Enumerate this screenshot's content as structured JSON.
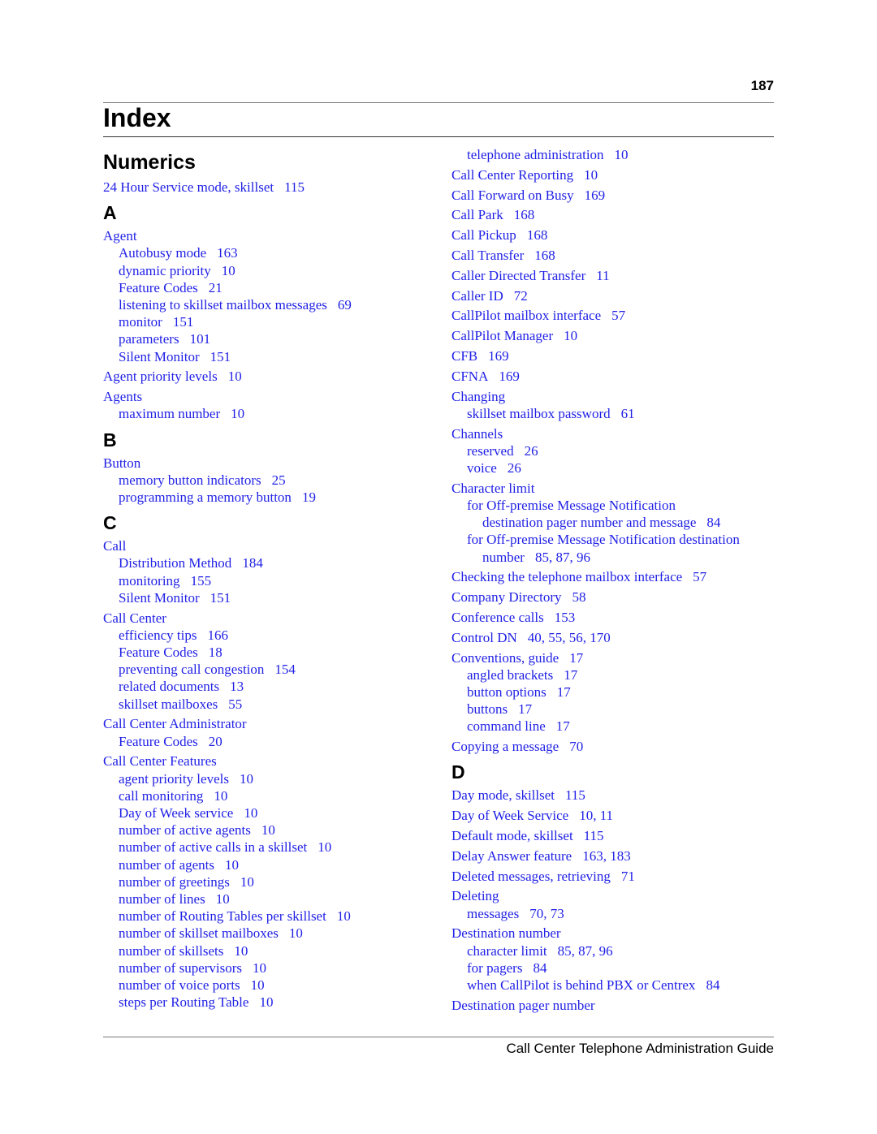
{
  "page": {
    "number": "187",
    "title": "Index",
    "footer": "Call Center Telephone Administration Guide"
  },
  "colors": {
    "link": "#1f1fe6",
    "heading": "#000000"
  },
  "columns": [
    [
      {
        "type": "head",
        "style": "big",
        "text": "Numerics"
      },
      {
        "level": 0,
        "text": "24 Hour Service mode, skillset",
        "pages": "115"
      },
      {
        "type": "head",
        "style": "letter",
        "text": "A"
      },
      {
        "level": 0,
        "text": "Agent",
        "pages": ""
      },
      {
        "level": 1,
        "text": "Autobusy mode",
        "pages": "163"
      },
      {
        "level": 1,
        "text": "dynamic priority",
        "pages": "10"
      },
      {
        "level": 1,
        "text": "Feature Codes",
        "pages": "21"
      },
      {
        "level": 1,
        "text": "listening to skillset mailbox messages",
        "pages": "69"
      },
      {
        "level": 1,
        "text": "monitor",
        "pages": "151"
      },
      {
        "level": 1,
        "text": "parameters",
        "pages": "101"
      },
      {
        "level": 1,
        "text": "Silent Monitor",
        "pages": "151"
      },
      {
        "level": 0,
        "text": "Agent priority levels",
        "pages": "10"
      },
      {
        "level": 0,
        "text": "Agents",
        "pages": ""
      },
      {
        "level": 1,
        "text": "maximum number",
        "pages": "10"
      },
      {
        "type": "head",
        "style": "letter",
        "text": "B"
      },
      {
        "level": 0,
        "text": "Button",
        "pages": ""
      },
      {
        "level": 1,
        "text": "memory button indicators",
        "pages": "25"
      },
      {
        "level": 1,
        "text": "programming a memory button",
        "pages": "19"
      },
      {
        "type": "head",
        "style": "letter",
        "text": "C"
      },
      {
        "level": 0,
        "text": "Call",
        "pages": ""
      },
      {
        "level": 1,
        "text": "Distribution Method",
        "pages": "184"
      },
      {
        "level": 1,
        "text": "monitoring",
        "pages": "155"
      },
      {
        "level": 1,
        "text": "Silent Monitor",
        "pages": "151"
      },
      {
        "level": 0,
        "text": "Call Center",
        "pages": ""
      },
      {
        "level": 1,
        "text": "efficiency tips",
        "pages": "166"
      },
      {
        "level": 1,
        "text": "Feature Codes",
        "pages": "18"
      },
      {
        "level": 1,
        "text": "preventing call congestion",
        "pages": "154"
      },
      {
        "level": 1,
        "text": "related documents",
        "pages": "13"
      },
      {
        "level": 1,
        "text": "skillset mailboxes",
        "pages": "55"
      },
      {
        "level": 0,
        "text": "Call Center Administrator",
        "pages": ""
      },
      {
        "level": 1,
        "text": "Feature Codes",
        "pages": "20"
      },
      {
        "level": 0,
        "text": "Call Center Features",
        "pages": ""
      },
      {
        "level": 1,
        "text": "agent priority levels",
        "pages": "10"
      },
      {
        "level": 1,
        "text": "call monitoring",
        "pages": "10"
      },
      {
        "level": 1,
        "text": "Day of Week service",
        "pages": "10"
      },
      {
        "level": 1,
        "text": "number of active agents",
        "pages": "10"
      },
      {
        "level": 1,
        "text": "number of active calls in a skillset",
        "pages": "10"
      },
      {
        "level": 1,
        "text": "number of agents",
        "pages": "10"
      },
      {
        "level": 1,
        "text": "number of greetings",
        "pages": "10"
      },
      {
        "level": 1,
        "text": "number of lines",
        "pages": "10"
      },
      {
        "level": 1,
        "text": "number of Routing Tables per skillset",
        "pages": "10"
      },
      {
        "level": 1,
        "text": "number of skillset mailboxes",
        "pages": "10"
      },
      {
        "level": 1,
        "text": "number of skillsets",
        "pages": "10"
      },
      {
        "level": 1,
        "text": "number of supervisors",
        "pages": "10"
      },
      {
        "level": 1,
        "text": "number of voice ports",
        "pages": "10"
      },
      {
        "level": 1,
        "text": "steps per Routing Table",
        "pages": "10"
      }
    ],
    [
      {
        "level": 1,
        "text": "telephone administration",
        "pages": "10"
      },
      {
        "level": 0,
        "text": "Call Center Reporting",
        "pages": "10"
      },
      {
        "level": 0,
        "text": "Call Forward on Busy",
        "pages": "169"
      },
      {
        "level": 0,
        "text": "Call Park",
        "pages": "168"
      },
      {
        "level": 0,
        "text": "Call Pickup",
        "pages": "168"
      },
      {
        "level": 0,
        "text": "Call Transfer",
        "pages": "168"
      },
      {
        "level": 0,
        "text": "Caller Directed Transfer",
        "pages": "11"
      },
      {
        "level": 0,
        "text": "Caller ID",
        "pages": "72"
      },
      {
        "level": 0,
        "text": "CallPilot mailbox interface",
        "pages": "57"
      },
      {
        "level": 0,
        "text": "CallPilot Manager",
        "pages": "10"
      },
      {
        "level": 0,
        "text": "CFB",
        "pages": "169"
      },
      {
        "level": 0,
        "text": "CFNA",
        "pages": "169"
      },
      {
        "level": 0,
        "text": "Changing",
        "pages": ""
      },
      {
        "level": 1,
        "text": "skillset mailbox password",
        "pages": "61"
      },
      {
        "level": 0,
        "text": "Channels",
        "pages": ""
      },
      {
        "level": 1,
        "text": "reserved",
        "pages": "26"
      },
      {
        "level": 1,
        "text": "voice",
        "pages": "26"
      },
      {
        "level": 0,
        "text": "Character limit",
        "pages": ""
      },
      {
        "level": 1,
        "text": "for Off-premise Message Notification",
        "pages": ""
      },
      {
        "level": 2,
        "text": "destination pager number and message",
        "pages": "84"
      },
      {
        "level": 1,
        "text": "for Off-premise Message Notification destination",
        "pages": ""
      },
      {
        "level": 2,
        "text": "number",
        "pages": "85, 87, 96"
      },
      {
        "level": 0,
        "text": "Checking the telephone mailbox interface",
        "pages": "57"
      },
      {
        "level": 0,
        "text": "Company Directory",
        "pages": "58"
      },
      {
        "level": 0,
        "text": "Conference calls",
        "pages": "153"
      },
      {
        "level": 0,
        "text": "Control DN",
        "pages": "40, 55, 56, 170"
      },
      {
        "level": 0,
        "text": "Conventions, guide",
        "pages": "17"
      },
      {
        "level": 1,
        "text": "angled brackets",
        "pages": "17"
      },
      {
        "level": 1,
        "text": "button options",
        "pages": "17"
      },
      {
        "level": 1,
        "text": "buttons",
        "pages": "17"
      },
      {
        "level": 1,
        "text": "command line",
        "pages": "17"
      },
      {
        "level": 0,
        "text": "Copying a message",
        "pages": "70"
      },
      {
        "type": "head",
        "style": "letter",
        "text": "D"
      },
      {
        "level": 0,
        "text": "Day mode, skillset",
        "pages": "115"
      },
      {
        "level": 0,
        "text": "Day of Week Service",
        "pages": "10, 11"
      },
      {
        "level": 0,
        "text": "Default mode, skillset",
        "pages": "115"
      },
      {
        "level": 0,
        "text": "Delay Answer feature",
        "pages": "163, 183"
      },
      {
        "level": 0,
        "text": "Deleted messages, retrieving",
        "pages": "71"
      },
      {
        "level": 0,
        "text": "Deleting",
        "pages": ""
      },
      {
        "level": 1,
        "text": "messages",
        "pages": "70, 73"
      },
      {
        "level": 0,
        "text": "Destination number",
        "pages": ""
      },
      {
        "level": 1,
        "text": "character limit",
        "pages": "85, 87, 96"
      },
      {
        "level": 1,
        "text": "for pagers",
        "pages": "84"
      },
      {
        "level": 1,
        "text": "when CallPilot is behind PBX or Centrex",
        "pages": "84"
      },
      {
        "level": 0,
        "text": "Destination pager number",
        "pages": ""
      }
    ]
  ]
}
